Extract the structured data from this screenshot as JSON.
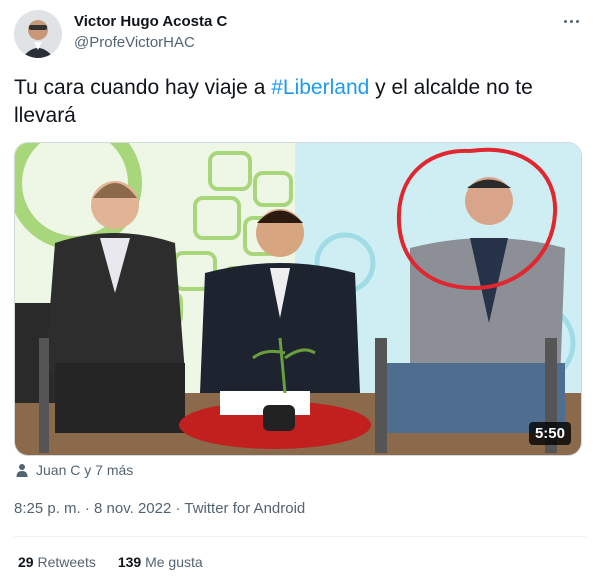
{
  "author": {
    "display_name": "Victor Hugo Acosta C",
    "handle": "@ProfeVictorHAC"
  },
  "tweet": {
    "text_before": "Tu cara cuando hay viaje a ",
    "hashtag": "#Liberland",
    "text_after": " y el alcalde no te llevará",
    "video_duration": "5:50",
    "tagged": "Juan C y 7 más",
    "timestamp": "8:25 p. m. · 8 nov. 2022 · Twitter for Android"
  },
  "stats": {
    "retweets_count": "29",
    "retweets_label": "Retweets",
    "likes_count": "139",
    "likes_label": "Me gusta"
  },
  "colors": {
    "link": "#1d9bf0",
    "secondary_text": "#536471",
    "highlight_circle": "#e0262f"
  }
}
